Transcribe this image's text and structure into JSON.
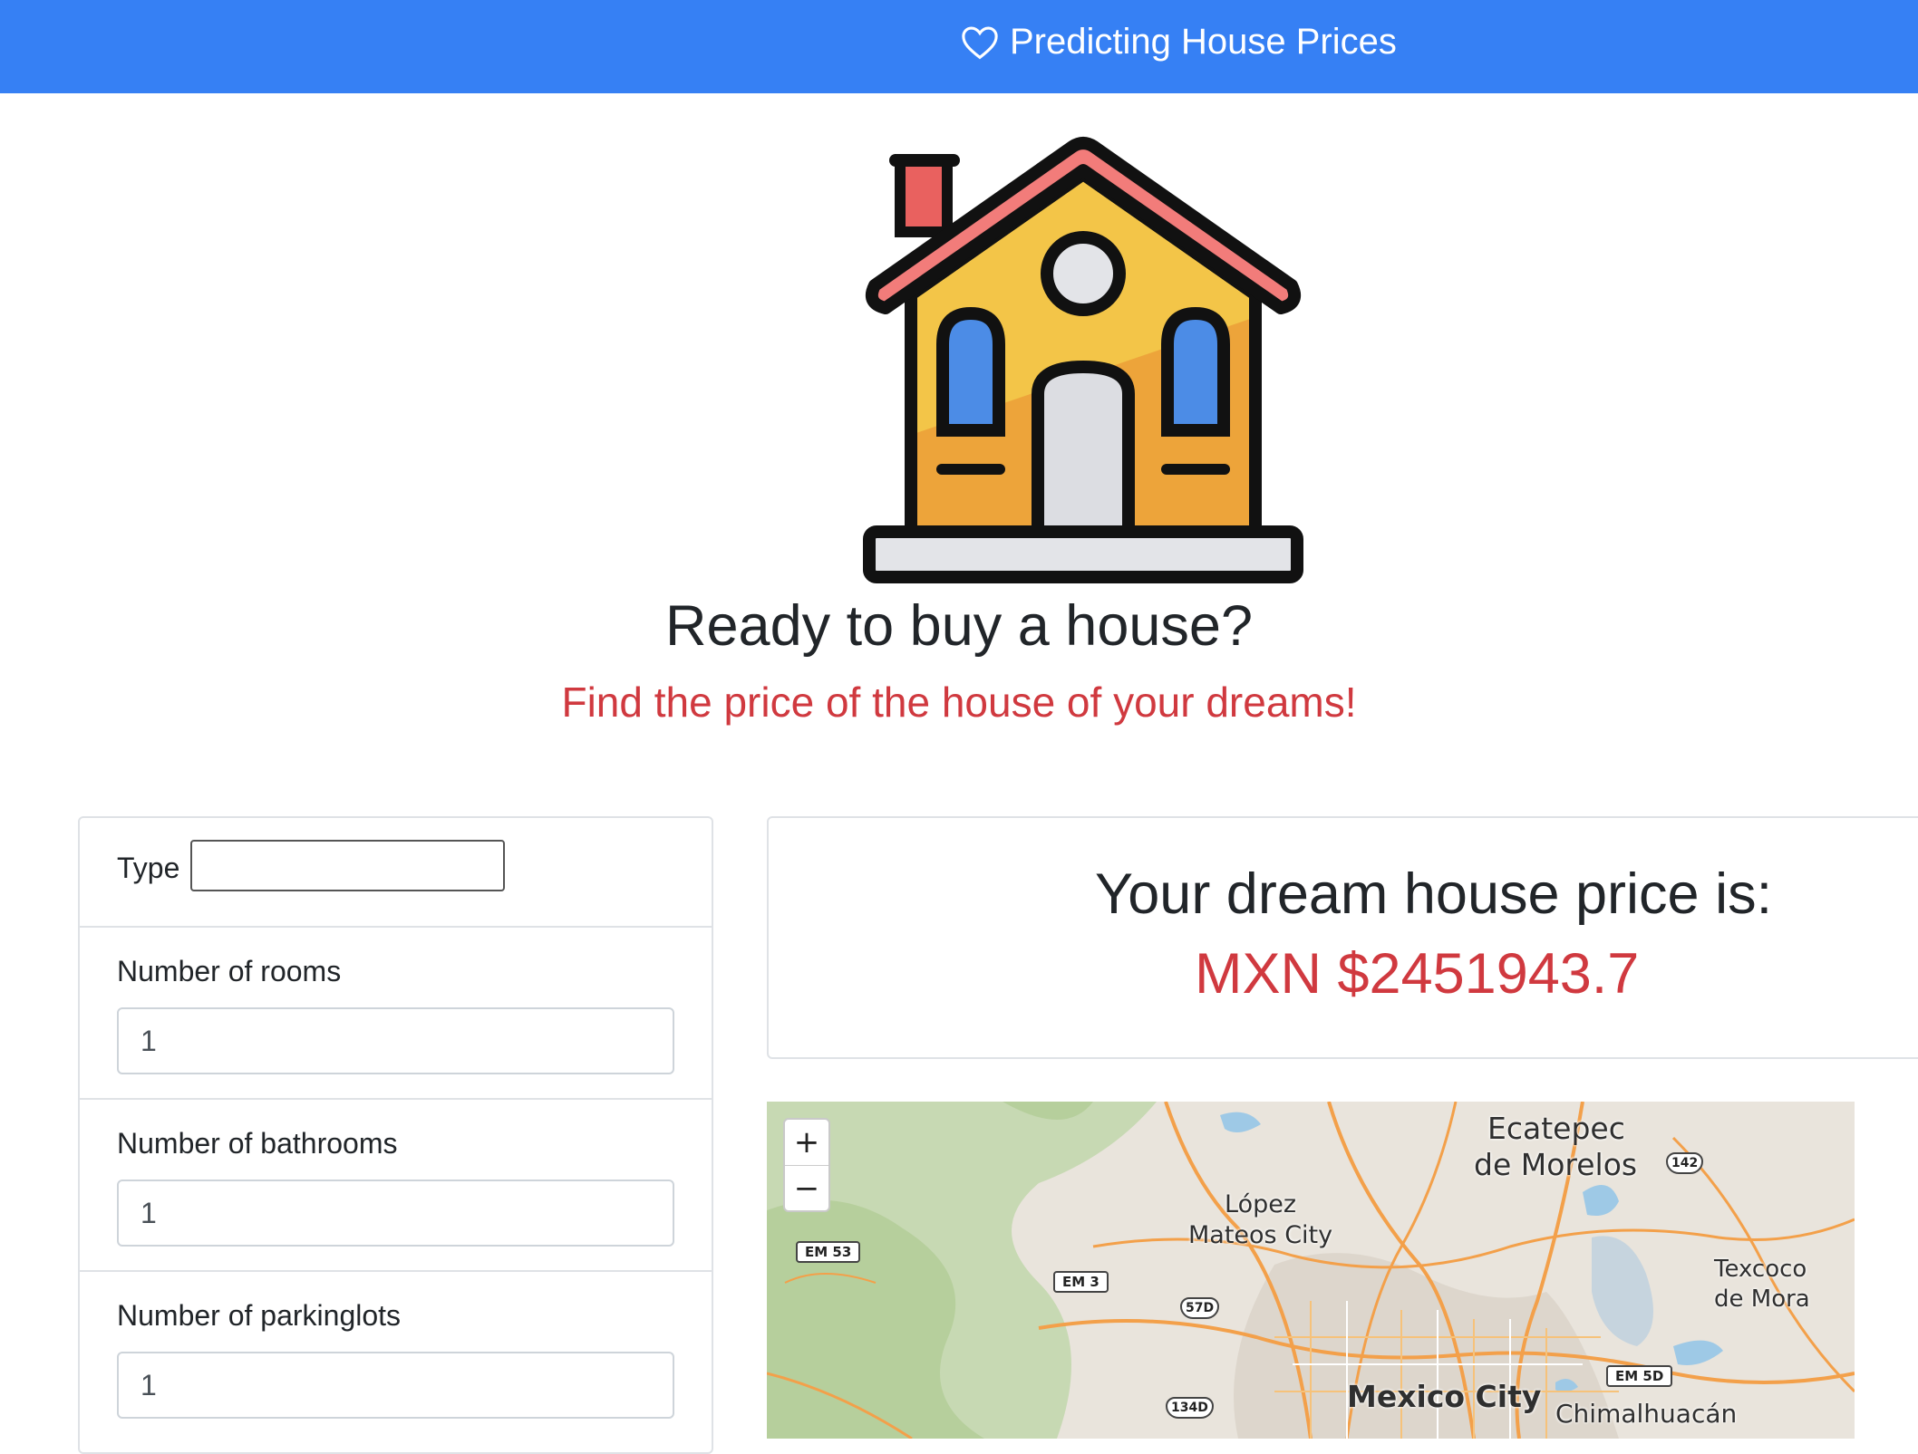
{
  "navbar": {
    "brand": "Predicting House Prices",
    "brand_icon": "heart-icon"
  },
  "hero": {
    "title": "Ready to buy a house?",
    "subtitle": "Find the price of the house of your dreams!"
  },
  "form": {
    "type_label": "Type",
    "type_value": "",
    "fields": [
      {
        "label": "Number of rooms",
        "value": "1"
      },
      {
        "label": "Number of bathrooms",
        "value": "1"
      },
      {
        "label": "Number of parkinglots",
        "value": "1"
      }
    ]
  },
  "result": {
    "title": "Your dream house price is:",
    "price": "MXN $2451943.7"
  },
  "map": {
    "zoom_in": "+",
    "zoom_out": "−",
    "places": {
      "ecatepec_1": "Ecatepec",
      "ecatepec_2": "de Morelos",
      "lopez_1": "López",
      "lopez_2": "Mateos City",
      "texcoco_1": "Texcoco",
      "texcoco_2": "de Mora",
      "mexico_city": "Mexico City",
      "chimalhuacan": "Chimalhuacán"
    },
    "shields": {
      "em53": "EM 53",
      "em3": "EM 3",
      "em5d": "EM 5D",
      "h57d": "57D",
      "h134d": "134D",
      "h142": "142"
    }
  },
  "colors": {
    "navbar": "#3680f4",
    "accent_red": "#d0393f"
  }
}
